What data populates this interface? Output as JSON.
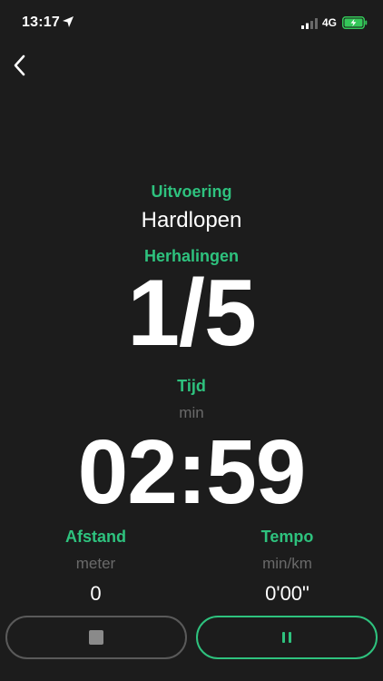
{
  "status_bar": {
    "time": "13:17",
    "network": "4G",
    "location_icon": "location-arrow-icon",
    "signal_icon": "signal-bars-icon",
    "battery_icon": "battery-charging-icon",
    "battery_color": "#34c759"
  },
  "nav": {
    "back_icon": "chevron-left-icon"
  },
  "workout": {
    "execution_label": "Uitvoering",
    "execution_value": "Hardlopen",
    "repetitions_label": "Herhalingen",
    "repetitions_value": "1/5",
    "time_label": "Tijd",
    "time_unit": "min",
    "time_value": "02:59"
  },
  "stats": {
    "distance": {
      "label": "Afstand",
      "unit": "meter",
      "value": "0"
    },
    "pace": {
      "label": "Tempo",
      "unit": "min/km",
      "value": "0'00\""
    }
  },
  "controls": {
    "stop_icon": "stop-icon",
    "pause_icon": "pause-icon"
  },
  "colors": {
    "accent": "#2ec27e",
    "background": "#1c1c1c",
    "muted": "#6a6a6a"
  }
}
